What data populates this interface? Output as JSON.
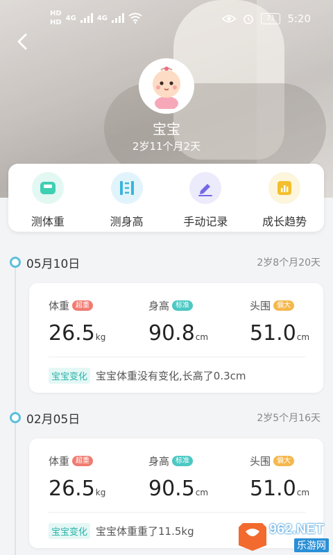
{
  "status_bar": {
    "sim1": "HD",
    "sim2": "HD",
    "network": "4G",
    "battery": "71",
    "time": "5:20"
  },
  "header": {
    "back_icon": "chevron-left-icon",
    "baby_name": "宝宝",
    "baby_age": "2岁11个月2天"
  },
  "actions": [
    {
      "label": "测体重",
      "icon": "scale-icon",
      "color": "#3fcfb2",
      "bg": "#e3f8f3"
    },
    {
      "label": "测身高",
      "icon": "height-ruler-icon",
      "color": "#3ab4dc",
      "bg": "#e2f4fb"
    },
    {
      "label": "手动记录",
      "icon": "pencil-icon",
      "color": "#7468e6",
      "bg": "#ecebfc"
    },
    {
      "label": "成长趋势",
      "icon": "bar-chart-icon",
      "color": "#f3bf2d",
      "bg": "#fdf5dc"
    }
  ],
  "records": [
    {
      "date": "05月10日",
      "age": "2岁8个月20天",
      "weight": {
        "name": "体重",
        "tag": "超重",
        "value": "26.5",
        "unit": "kg"
      },
      "height": {
        "name": "身高",
        "tag": "标准",
        "value": "90.8",
        "unit": "cm"
      },
      "head": {
        "name": "头围",
        "tag": "偏大",
        "value": "51.0",
        "unit": "cm"
      },
      "note_tag": "宝宝变化",
      "note": "宝宝体重没有变化,长高了0.3cm"
    },
    {
      "date": "02月05日",
      "age": "2岁5个月16天",
      "weight": {
        "name": "体重",
        "tag": "超重",
        "value": "26.5",
        "unit": "kg"
      },
      "height": {
        "name": "身高",
        "tag": "标准",
        "value": "90.5",
        "unit": "cm"
      },
      "head": {
        "name": "头围",
        "tag": "偏大",
        "value": "51.0",
        "unit": "cm"
      },
      "note_tag": "宝宝变化",
      "note": "宝宝体重重了11.5kg"
    }
  ],
  "watermark": {
    "brand": "962.NET",
    "sub": "乐游网"
  }
}
